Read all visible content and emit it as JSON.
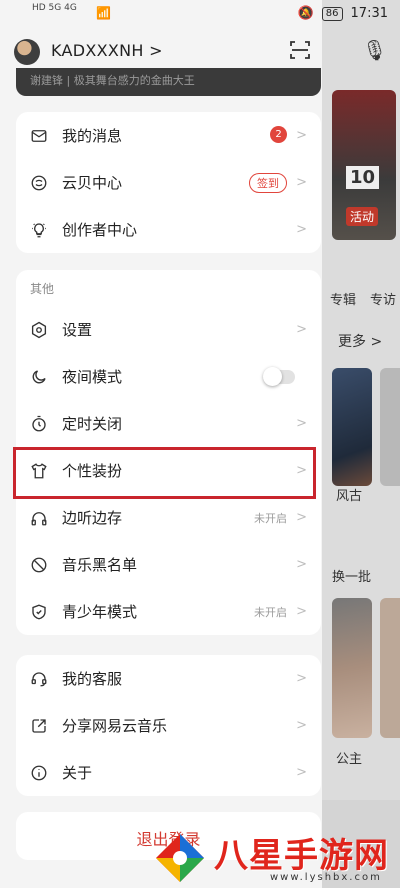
{
  "status_bar": {
    "sim_label": "HD 5G 4G",
    "battery": "86",
    "time": "17:31"
  },
  "profile": {
    "username": "KADXXXNH >",
    "scan_icon": "scan-icon"
  },
  "promo_text": "谢建锋 | 极其舞台感力的金曲大王",
  "group1": [
    {
      "label": "我的消息",
      "icon": "mail-icon",
      "badge": "2"
    },
    {
      "label": "云贝中心",
      "icon": "coin-icon",
      "action": "签到"
    },
    {
      "label": "创作者中心",
      "icon": "bulb-icon"
    }
  ],
  "group2": {
    "title": "其他",
    "items": [
      {
        "label": "设置",
        "icon": "settings-icon"
      },
      {
        "label": "夜间模式",
        "icon": "moon-icon",
        "toggle": false
      },
      {
        "label": "定时关闭",
        "icon": "timer-icon"
      },
      {
        "label": "个性装扮",
        "icon": "tshirt-icon"
      },
      {
        "label": "边听边存",
        "icon": "headphones-icon",
        "status": "未开启"
      },
      {
        "label": "音乐黑名单",
        "icon": "block-icon"
      },
      {
        "label": "青少年模式",
        "icon": "shield-icon",
        "status": "未开启"
      }
    ]
  },
  "group3": [
    {
      "label": "我的客服",
      "icon": "headset-icon"
    },
    {
      "label": "分享网易云音乐",
      "icon": "share-icon"
    },
    {
      "label": "关于",
      "icon": "info-icon"
    }
  ],
  "logout": "退出登录",
  "background_app": {
    "banner_date": "10",
    "banner_tag": "活动",
    "more": "更多 >",
    "cat1": "专辑",
    "cat2": "专访",
    "card_caption": "风古",
    "swap": "换一批",
    "caption2": "公主"
  },
  "watermark": {
    "name": "八星手游网",
    "url": "www.lyshbx.com"
  },
  "colors": {
    "accent": "#e1453c",
    "highlight_border": "#c9252d"
  }
}
